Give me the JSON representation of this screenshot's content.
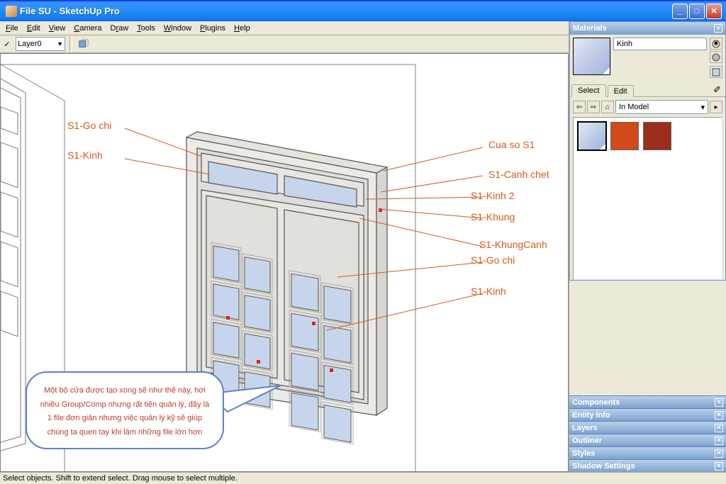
{
  "window": {
    "title": "File SU - SketchUp Pro"
  },
  "menu": {
    "file": "File",
    "edit": "Edit",
    "view": "View",
    "camera": "Camera",
    "draw": "Draw",
    "tools": "Tools",
    "window": "Window",
    "plugins": "Plugins",
    "help": "Help"
  },
  "toolbar": {
    "layer": "Layer0"
  },
  "materials": {
    "title": "Materials",
    "current_name": "Kinh",
    "tab_select": "Select",
    "tab_edit": "Edit",
    "collection": "In Model"
  },
  "collapsed": {
    "components": "Components",
    "entity_info": "Entity Info",
    "layers": "Layers",
    "outliner": "Outliner",
    "styles": "Styles",
    "shadow": "Shadow Settings"
  },
  "status": "Select objects. Shift to extend select. Drag mouse to select multiple.",
  "labels": {
    "l1": "S1-Go chi",
    "l2": "S1-Kinh",
    "l3": "Cua so S1",
    "l4": "S1-Canh chet",
    "l5": "S1-Kinh 2",
    "l6": "S1-Khung",
    "l7": "S1-KhungCanh",
    "l8": "S1-Go chi",
    "l9": "S1-Kinh"
  },
  "speech_text": "Một bộ cửa được tạo xong sẽ như thế này, hơi nhiều Group/Comp nhưng rất tiện quản lý, đây là 1 file đơn giản nhưng việc quản lý kỹ sẽ giúp chúng ta quen tay khi làm những file lớn hơn"
}
